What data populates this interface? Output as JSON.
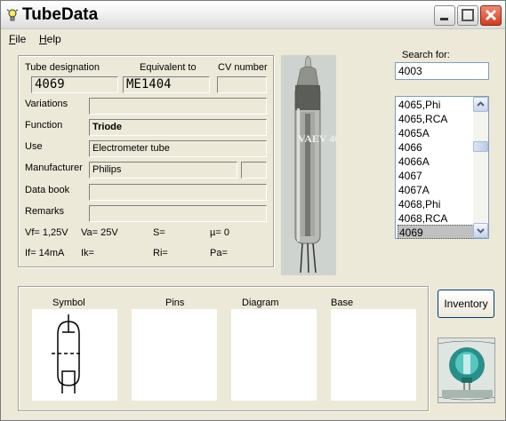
{
  "window": {
    "title": "TubeData"
  },
  "menu": [
    "File",
    "Help"
  ],
  "header_labels": {
    "designation": "Tube designation",
    "equivalent": "Equivalent to",
    "cv": "CV number"
  },
  "tube": {
    "designation": "4069",
    "equivalent": "ME1404",
    "cv": "",
    "variations": "",
    "function": "Triode",
    "use": "Electrometer tube",
    "manufacturer": "Philips",
    "manufacturer_code": "",
    "data_book": "",
    "remarks": ""
  },
  "field_labels": {
    "variations": "Variations",
    "function": "Function",
    "use": "Use",
    "manufacturer": "Manufacturer",
    "data_book": "Data book",
    "remarks": "Remarks"
  },
  "params": {
    "vf": "Vf= 1,25V",
    "va": "Va= 25V",
    "s": "S=",
    "mu": "µ=    0",
    "if": "If= 14mA",
    "ik": "Ik=",
    "ri": "Ri=",
    "pa": "Pa="
  },
  "search": {
    "label": "Search for:",
    "value": "4003"
  },
  "list": {
    "items": [
      "4065,Phi",
      "4065,RCA",
      "4065A",
      "4066",
      "4066A",
      "4067",
      "4067A",
      "4068,Phi",
      "4068,RCA",
      "4069"
    ],
    "selected": "4069"
  },
  "bottom_panels": [
    "Symbol",
    "Pins",
    "Diagram",
    "Base"
  ],
  "inventory_label": "Inventory",
  "photo_text": "VAEV 406",
  "icons": {
    "app": "lightbulb-icon",
    "minimize": "minimize-icon",
    "maximize": "maximize-icon",
    "close": "close-icon"
  },
  "colors": {
    "window_bg": "#ece9d8",
    "close_button": "#d33a1c",
    "list_selection": "#c0c0c0"
  }
}
